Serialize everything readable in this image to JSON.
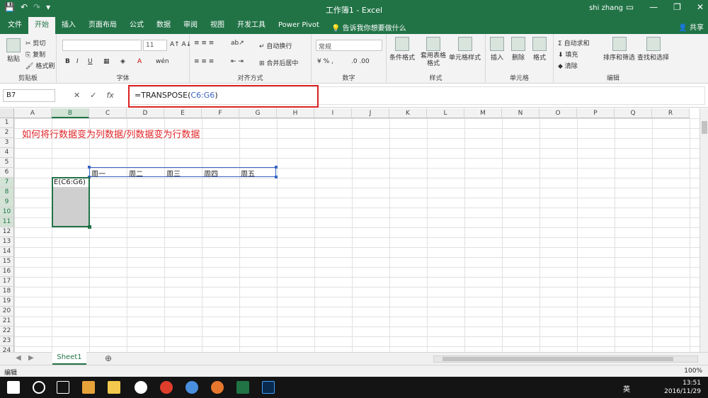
{
  "window": {
    "title": "工作簿1 - Excel",
    "user": "shi zhang",
    "share": "共享"
  },
  "menu": {
    "tabs": [
      "文件",
      "开始",
      "插入",
      "页面布局",
      "公式",
      "数据",
      "审阅",
      "视图",
      "开发工具",
      "Power Pivot"
    ],
    "tellme": "告诉我你想要做什么"
  },
  "ribbon": {
    "clipboard": {
      "label": "剪贴板",
      "paste": "粘贴",
      "cut": "剪切",
      "copy": "复制",
      "painter": "格式刷"
    },
    "font": {
      "label": "字体",
      "size": "11",
      "bold": "B",
      "italic": "I",
      "underline": "U"
    },
    "align": {
      "label": "对齐方式",
      "wrap": "自动换行",
      "merge": "合并后居中"
    },
    "number": {
      "label": "数字",
      "format": "常规"
    },
    "styles": {
      "label": "样式",
      "cond": "条件格式",
      "table": "套用表格格式",
      "cell": "单元格样式"
    },
    "cells": {
      "label": "单元格",
      "insert": "插入",
      "delete": "删除",
      "format": "格式"
    },
    "editing": {
      "label": "编辑",
      "autosum": "自动求和",
      "fill": "填充",
      "clear": "清除",
      "sort": "排序和筛选",
      "find": "查找和选择"
    }
  },
  "formula": {
    "namebox": "B7",
    "prefix": "=TRANSPOSE(",
    "ref": "C6:G6",
    "suffix": ")"
  },
  "columns": [
    "A",
    "B",
    "C",
    "D",
    "E",
    "F",
    "G",
    "H",
    "I",
    "J",
    "K",
    "L",
    "M",
    "N",
    "O",
    "P",
    "Q",
    "R"
  ],
  "rows": [
    "1",
    "2",
    "3",
    "4",
    "5",
    "6",
    "7",
    "8",
    "9",
    "10",
    "11",
    "12",
    "13",
    "14",
    "15",
    "16",
    "17",
    "18",
    "19",
    "20",
    "21",
    "22",
    "23",
    "24"
  ],
  "cells": {
    "heading": "如何将行数据变为列数据/列数据变为行数据",
    "c6": "周一",
    "d6": "周二",
    "e6": "周三",
    "f6": "周四",
    "g6": "周五",
    "b7": "E(C6:G6)"
  },
  "sheet": {
    "tab": "Sheet1"
  },
  "status": {
    "mode": "编辑",
    "zoom": "100%"
  },
  "taskbar": {
    "time": "13:51",
    "date": "2016/11/29",
    "lang": "英"
  }
}
